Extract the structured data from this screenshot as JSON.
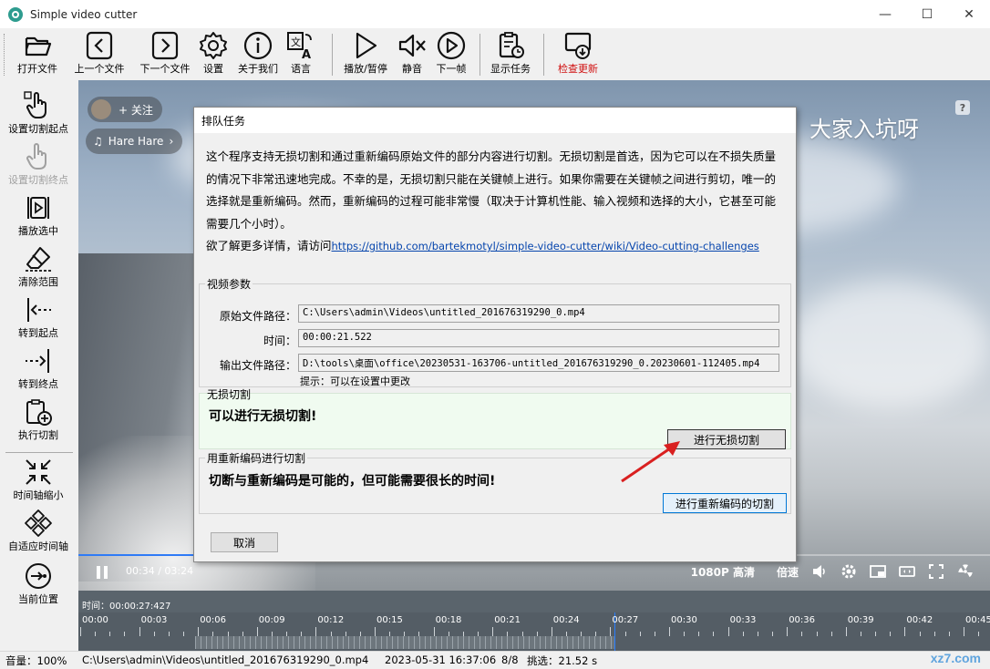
{
  "window": {
    "title": "Simple video cutter",
    "minimize": "—",
    "maximize": "☐",
    "close": "✕"
  },
  "toolbar": {
    "open_file": "打开文件",
    "prev_file": "上一个文件",
    "next_file": "下一个文件",
    "settings": "设置",
    "about": "关于我们",
    "language": "语言",
    "play_pause": "播放/暂停",
    "mute": "静音",
    "next_frame": "下一帧",
    "show_tasks": "显示任务",
    "check_update": "检查更新"
  },
  "sidebar": {
    "set_start": "设置切割起点",
    "set_end": "设置切割终点",
    "play_selection": "播放选中",
    "clear_range": "清除范围",
    "goto_start": "转到起点",
    "goto_end": "转到终点",
    "execute_cut": "执行切割",
    "timeline_shrink": "时间轴缩小",
    "fit_timeline": "自适应时间轴",
    "current_position": "当前位置"
  },
  "video": {
    "follow": "+ 关注",
    "music": "Hare Hare",
    "subtitle": "大家入坑呀",
    "help": "?",
    "current_time": "00:34",
    "total_time": "03:24",
    "time_sep": " / ",
    "quality": "1080P 高清",
    "speed": "倍速",
    "progress_fraction": 0.13
  },
  "dialog": {
    "title": "排队任务",
    "description": "这个程序支持无损切割和通过重新编码原始文件的部分内容进行切割。无损切割是首选，因为它可以在不损失质量的情况下非常迅速地完成。不幸的是，无损切割只能在关键帧上进行。如果你需要在关键帧之间进行剪切，唯一的选择就是重新编码。然而，重新编码的过程可能非常慢（取决于计算机性能、输入视频和选择的大小，它甚至可能需要几个小时）。",
    "more_info": "欲了解更多详情，请访问",
    "link": "https://github.com/bartekmotyl/simple-video-cutter/wiki/Video-cutting-challenges",
    "video_params_title": "视频参数",
    "source_label": "原始文件路径：",
    "source_value": "C:\\Users\\admin\\Videos\\untitled_201676319290_0.mp4",
    "time_label": "时间：",
    "time_value": "00:00:21.522",
    "output_label": "输出文件路径：",
    "output_value": "D:\\tools\\桌面\\office\\20230531-163706-untitled_201676319290_0.20230601-112405.mp4",
    "hint": "提示：可以在设置中更改",
    "lossless_title": "无损切割",
    "lossless_text": "可以进行无损切割!",
    "lossless_button": "进行无损切割",
    "reencode_title": "用重新编码进行切割",
    "reencode_text": "切断与重新编码是可能的，但可能需要很长的时间!",
    "reencode_button": "进行重新编码的切割",
    "cancel": "取消"
  },
  "timeline": {
    "time_label": "时间：00:00:27:427",
    "ticks": [
      "00:00",
      "00:03",
      "00:06",
      "00:09",
      "00:12",
      "00:15",
      "00:18",
      "00:21",
      "00:24",
      "00:27",
      "00:30",
      "00:33",
      "00:36",
      "00:39",
      "00:42",
      "00:45"
    ]
  },
  "status": {
    "volume": "音量：100%",
    "file": "C:\\Users\\admin\\Videos\\untitled_201676319290_0.mp4",
    "date": "2023-05-31 16:37:06",
    "count": "8/8",
    "selection": "挑选：21.52 s"
  },
  "watermark": "xz7.com",
  "colors": {
    "accent": "#0078d7",
    "update_red": "#d01010",
    "link": "#0645ad",
    "green_panel": "#f0fbf0"
  }
}
